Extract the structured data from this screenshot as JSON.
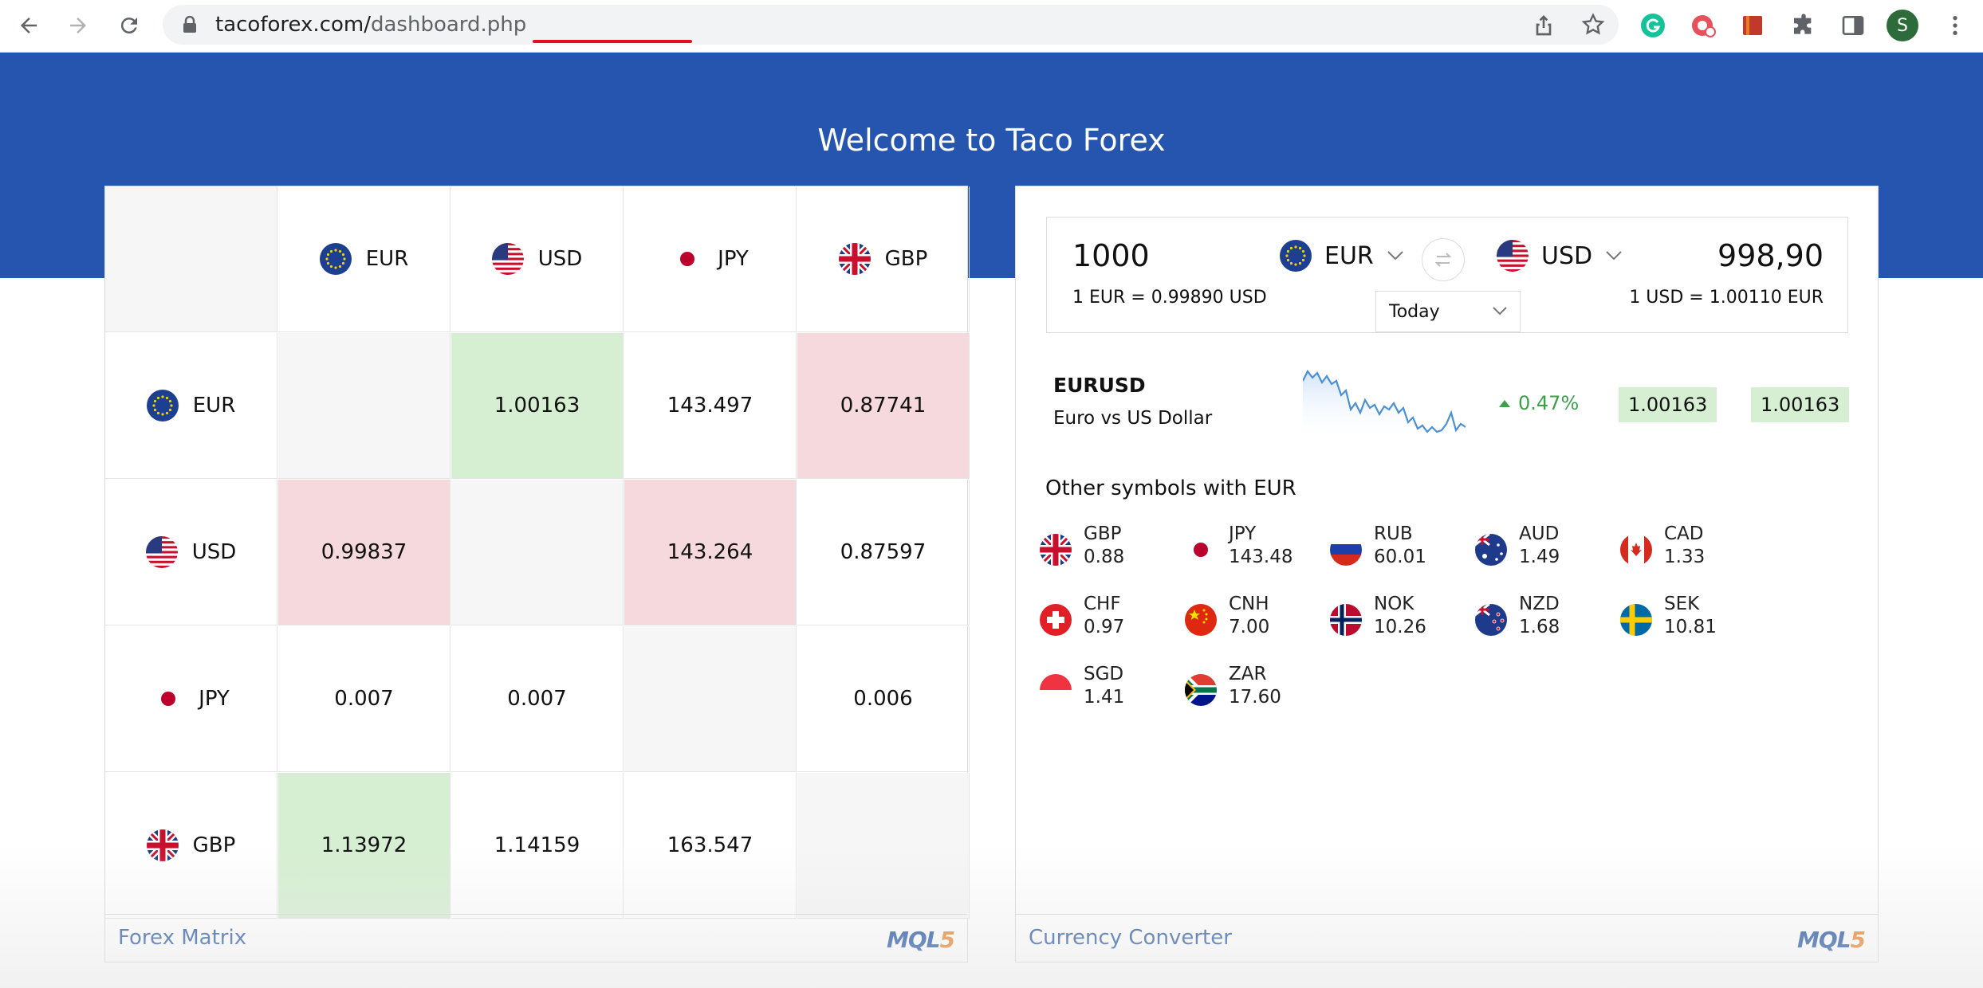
{
  "browser": {
    "url_host": "tacoforex.com/",
    "url_path": "dashboard.php",
    "avatar_initial": "S",
    "icons": [
      "back-icon",
      "forward-icon",
      "reload-icon",
      "lock-icon",
      "share-icon",
      "bookmark-star-icon",
      "grammarly-icon",
      "extension-icon",
      "bookmark-app-icon",
      "puzzle-icon",
      "side-panel-icon",
      "menu-icon"
    ],
    "underline_color": "#e0121e"
  },
  "header": {
    "title": "Welcome to Taco Forex",
    "color": "#2655b0"
  },
  "matrix": {
    "columns": [
      "EUR",
      "USD",
      "JPY",
      "GBP"
    ],
    "rows": [
      {
        "label": "EUR",
        "cells": [
          {
            "value": "",
            "state": "blank"
          },
          {
            "value": "1.00163",
            "state": "up"
          },
          {
            "value": "143.497",
            "state": "none"
          },
          {
            "value": "0.87741",
            "state": "down"
          }
        ]
      },
      {
        "label": "USD",
        "cells": [
          {
            "value": "0.99837",
            "state": "down"
          },
          {
            "value": "",
            "state": "blank"
          },
          {
            "value": "143.264",
            "state": "down"
          },
          {
            "value": "0.87597",
            "state": "none"
          }
        ]
      },
      {
        "label": "JPY",
        "cells": [
          {
            "value": "0.007",
            "state": "none"
          },
          {
            "value": "0.007",
            "state": "none"
          },
          {
            "value": "",
            "state": "blank"
          },
          {
            "value": "0.006",
            "state": "none"
          }
        ]
      },
      {
        "label": "GBP",
        "cells": [
          {
            "value": "1.13972",
            "state": "up"
          },
          {
            "value": "1.14159",
            "state": "none"
          },
          {
            "value": "163.547",
            "state": "none"
          },
          {
            "value": "",
            "state": "blank"
          }
        ]
      }
    ],
    "footer_label": "Forex Matrix",
    "brand": {
      "main": "MQL",
      "digit": "5"
    },
    "colors": {
      "up": "#d6efd2",
      "down": "#f6d9dc",
      "blank": "#f6f6f6"
    }
  },
  "converter": {
    "amount": "1000",
    "from_currency": "EUR",
    "to_currency": "USD",
    "result": "998,90",
    "from_rate": "1 EUR = 0.99890 USD",
    "to_rate": "1 USD = 1.00110 EUR",
    "period": "Today",
    "symbol": {
      "name": "EURUSD",
      "description": "Euro vs US Dollar",
      "change": "0.47%",
      "bid": "1.00163",
      "ask": "1.00163",
      "trend": "up"
    },
    "other_title": "Other symbols with EUR",
    "others": [
      {
        "code": "GBP",
        "value": "0.88"
      },
      {
        "code": "JPY",
        "value": "143.48"
      },
      {
        "code": "RUB",
        "value": "60.01"
      },
      {
        "code": "AUD",
        "value": "1.49"
      },
      {
        "code": "CAD",
        "value": "1.33"
      },
      {
        "code": "CHF",
        "value": "0.97"
      },
      {
        "code": "CNH",
        "value": "7.00"
      },
      {
        "code": "NOK",
        "value": "10.26"
      },
      {
        "code": "NZD",
        "value": "1.68"
      },
      {
        "code": "SEK",
        "value": "10.81"
      },
      {
        "code": "SGD",
        "value": "1.41"
      },
      {
        "code": "ZAR",
        "value": "17.60"
      }
    ],
    "footer_label": "Currency Converter",
    "brand": {
      "main": "MQL",
      "digit": "5"
    }
  }
}
